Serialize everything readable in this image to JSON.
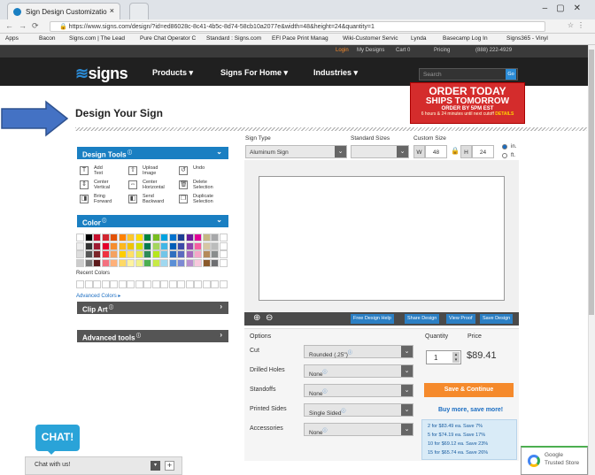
{
  "browser": {
    "tab_title": "Sign Design Customizatio",
    "tab_close": "×",
    "url": "https://www.signs.com/design/?id=ed86028c-8c41-4b5c-8d74-58cb10a2077e&width=48&height=24&quantity=1",
    "bookmarks": [
      "Apps",
      "Bacon",
      "Signs.com | The Lead",
      "Pure Chat Operator C",
      "Standard : Signs.com",
      "EFI Pace Print Manag",
      "Wiki-Customer Servic",
      "Lynda",
      "Basecamp Log In",
      "Signs365 - Vinyl"
    ]
  },
  "site": {
    "topstrip": [
      "Login",
      "My Designs",
      "Cart 0",
      "Pricing",
      "(888) 222-4929"
    ],
    "logo": "signs",
    "logo_sub": ".com",
    "nav": [
      "Products ▾",
      "Signs For Home ▾",
      "Industries ▾"
    ],
    "search_placeholder": "Search",
    "search_go": "Go"
  },
  "promo": {
    "line1": "ORDER TODAY",
    "line2": "SHIPS TOMORROW",
    "line3": "ORDER BY 5PM EST",
    "line4": "6 hours & 24 minutes until next cutoff",
    "details": "DETAILS"
  },
  "page": {
    "title": "Design Your Sign"
  },
  "design_tools": {
    "header": "Design Tools",
    "tools": [
      {
        "label": "Add\nText",
        "icon": "text-icon"
      },
      {
        "label": "Upload\nImage",
        "icon": "upload-icon"
      },
      {
        "label": "Undo",
        "icon": "undo-icon"
      },
      {
        "label": "Center\nVertical",
        "icon": "center-vertical-icon"
      },
      {
        "label": "Center\nHorizontal",
        "icon": "center-horizontal-icon"
      },
      {
        "label": "Delete\nSelection",
        "icon": "trash-icon"
      },
      {
        "label": "Bring\nForward",
        "icon": "bring-forward-icon"
      },
      {
        "label": "Send\nBackward",
        "icon": "send-backward-icon"
      },
      {
        "label": "Duplicate\nSelection",
        "icon": "duplicate-icon"
      }
    ]
  },
  "color": {
    "header": "Color",
    "recent_label": "Recent Colors",
    "advanced_label": "Advanced Colors ▸",
    "rows": [
      [
        "#ffffff",
        "#000000",
        "#c8102e",
        "#d22630",
        "#e35205",
        "#ff8200",
        "#ffc72c",
        "#fedd00",
        "#00843d",
        "#78be20",
        "#00a3e0",
        "#0072ce",
        "#1b3f94",
        "#6a1b9a",
        "#e10098",
        "#c5b783",
        "#a7a8aa",
        "#ffffff"
      ],
      [
        "#eeeeee",
        "#333333",
        "#9e1b32",
        "#e4002b",
        "#f68d2e",
        "#ffb81c",
        "#f1c400",
        "#d0df00",
        "#007a53",
        "#a4d65e",
        "#41b6e6",
        "#005eb8",
        "#3b4aa8",
        "#8e44ad",
        "#f65ea1",
        "#d6c6a4",
        "#bbbcbc",
        "#ffffff"
      ],
      [
        "#dddddd",
        "#555555",
        "#7c2529",
        "#ef3340",
        "#f4a261",
        "#ffcd00",
        "#ffe066",
        "#e5e84f",
        "#2e8b57",
        "#b5e61d",
        "#71c5e8",
        "#2f6fbf",
        "#5b6bbf",
        "#a569bd",
        "#f4a6c8",
        "#b48a5a",
        "#898d8d",
        "#ffffff"
      ],
      [
        "#cccccc",
        "#777777",
        "#5c1a1b",
        "#f4717f",
        "#ffb07a",
        "#ffd966",
        "#fff3a0",
        "#f1f18a",
        "#4caf50",
        "#c7ea46",
        "#9fd8f0",
        "#5b8fd6",
        "#7d8ad4",
        "#bb8fce",
        "#f8c8dc",
        "#8b5a2b",
        "#6d6e71",
        "#ffffff"
      ]
    ]
  },
  "clip_art": {
    "header": "Clip Art"
  },
  "advanced_tools": {
    "header": "Advanced tools"
  },
  "editor": {
    "sign_type_label": "Sign Type",
    "sign_type_value": "Aluminum Sign",
    "standard_sizes_label": "Standard Sizes",
    "custom_size_label": "Custom Size",
    "w_label": "W",
    "w_value": "48",
    "h_label": "H",
    "h_value": "24",
    "unit_in": "in.",
    "unit_ft": "ft.",
    "toolbar": [
      "Free Design Help",
      "Share Design",
      "View Proof",
      "Save Design"
    ]
  },
  "options": {
    "header": "Options",
    "quantity_header": "Quantity",
    "price_header": "Price",
    "rows": [
      {
        "label": "Cut",
        "value": "Rounded (.25\")"
      },
      {
        "label": "Drilled Holes",
        "value": "None"
      },
      {
        "label": "Standoffs",
        "value": "None"
      },
      {
        "label": "Printed Sides",
        "value": "Single Sided"
      },
      {
        "label": "Accessories",
        "value": "None"
      }
    ],
    "quantity": "1",
    "price": "$89.41",
    "save_button": "Save & Continue",
    "buy_more": "Buy more, save more!",
    "discounts": [
      "2 for $83.49 ea. Save 7%",
      "5 for $74.19 ea. Save 17%",
      "10 for $69.12 ea. Save 23%",
      "15 for $65.74 ea. Save 26%"
    ]
  },
  "chat": {
    "bubble": "CHAT!",
    "bar_label": "Chat with us!"
  },
  "trusted_store": {
    "line1": "Google",
    "line2": "Trusted Store"
  }
}
